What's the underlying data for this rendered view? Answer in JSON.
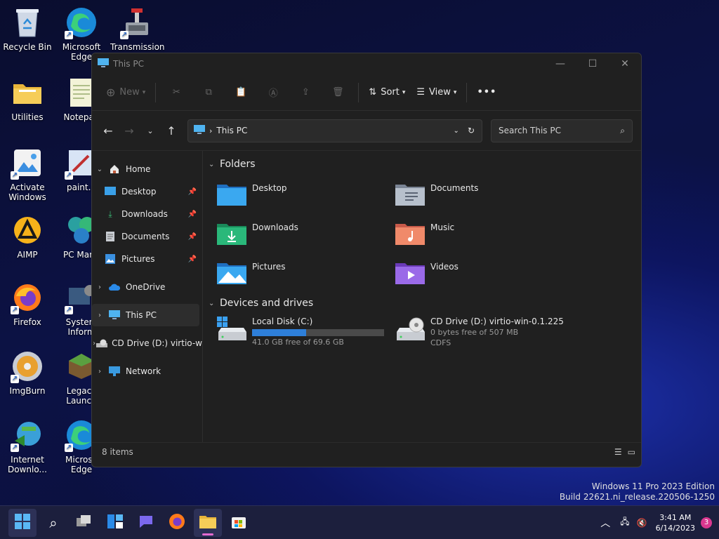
{
  "desktop": {
    "icons": [
      {
        "label": "Recycle Bin"
      },
      {
        "label": "Microsoft Edge"
      },
      {
        "label": "Transmission"
      },
      {
        "label": "Utilities"
      },
      {
        "label": "Notepad"
      },
      {
        "label": "Activate Windows"
      },
      {
        "label": "paint.n"
      },
      {
        "label": "AIMP"
      },
      {
        "label": "PC Mana"
      },
      {
        "label": "Firefox"
      },
      {
        "label": "System Inform"
      },
      {
        "label": "ImgBurn"
      },
      {
        "label": "Legacy Launch"
      },
      {
        "label": "Internet Downlo..."
      },
      {
        "label": "Microso Edge"
      }
    ]
  },
  "window": {
    "title": "This PC",
    "toolbar": {
      "new_label": "New",
      "sort_label": "Sort",
      "view_label": "View",
      "more_label": "•••"
    },
    "address": {
      "path": "This PC"
    },
    "search": {
      "placeholder": "Search This PC"
    },
    "sidebar": {
      "items": [
        {
          "label": "Home"
        },
        {
          "label": "Desktop"
        },
        {
          "label": "Downloads"
        },
        {
          "label": "Documents"
        },
        {
          "label": "Pictures"
        },
        {
          "label": "OneDrive"
        },
        {
          "label": "This PC"
        },
        {
          "label": "CD Drive (D:) virtio-w"
        },
        {
          "label": "Network"
        }
      ]
    },
    "folders_header": "Folders",
    "folders": [
      {
        "label": "Desktop"
      },
      {
        "label": "Documents"
      },
      {
        "label": "Downloads"
      },
      {
        "label": "Music"
      },
      {
        "label": "Pictures"
      },
      {
        "label": "Videos"
      }
    ],
    "drives_header": "Devices and drives",
    "drives": [
      {
        "name": "Local Disk (C:)",
        "free": "41.0 GB free of 69.6 GB",
        "used_fraction": 0.41
      },
      {
        "name": "CD Drive (D:) virtio-win-0.1.225",
        "free": "0 bytes free of 507 MB",
        "fs": "CDFS"
      }
    ],
    "status": {
      "items": "8 items"
    }
  },
  "watermark": {
    "line1": "Windows 11 Pro 2023 Edition",
    "line2": "Build 22621.ni_release.220506-1250"
  },
  "taskbar": {
    "time": "3:41 AM",
    "date": "6/14/2023",
    "notification_count": "3"
  },
  "colors": {
    "accent": "#2e7fd9",
    "window_bg": "#202020",
    "taskbar_bg": "#1c1f3d"
  }
}
